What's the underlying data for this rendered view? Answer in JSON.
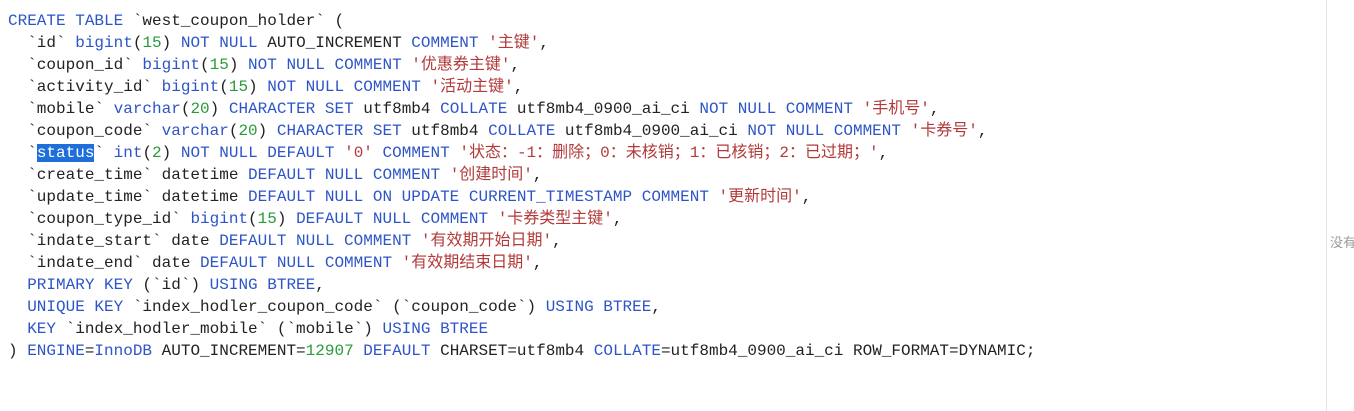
{
  "editor": {
    "lines": [
      [
        {
          "t": "CREATE TABLE",
          "k": "kw"
        },
        {
          "t": " `west_coupon_holder` (",
          "k": "plain"
        }
      ],
      [
        {
          "t": "  `id` ",
          "k": "plain"
        },
        {
          "t": "bigint",
          "k": "kw"
        },
        {
          "t": "(",
          "k": "plain"
        },
        {
          "t": "15",
          "k": "num"
        },
        {
          "t": ") ",
          "k": "plain"
        },
        {
          "t": "NOT NULL",
          "k": "kw"
        },
        {
          "t": " AUTO_INCREMENT ",
          "k": "plain"
        },
        {
          "t": "COMMENT",
          "k": "kw"
        },
        {
          "t": " ",
          "k": "plain"
        },
        {
          "t": "'主键'",
          "k": "str"
        },
        {
          "t": ",",
          "k": "plain"
        }
      ],
      [
        {
          "t": "  `coupon_id` ",
          "k": "plain"
        },
        {
          "t": "bigint",
          "k": "kw"
        },
        {
          "t": "(",
          "k": "plain"
        },
        {
          "t": "15",
          "k": "num"
        },
        {
          "t": ") ",
          "k": "plain"
        },
        {
          "t": "NOT NULL COMMENT",
          "k": "kw"
        },
        {
          "t": " ",
          "k": "plain"
        },
        {
          "t": "'优惠券主键'",
          "k": "str"
        },
        {
          "t": ",",
          "k": "plain"
        }
      ],
      [
        {
          "t": "  `activity_id` ",
          "k": "plain"
        },
        {
          "t": "bigint",
          "k": "kw"
        },
        {
          "t": "(",
          "k": "plain"
        },
        {
          "t": "15",
          "k": "num"
        },
        {
          "t": ") ",
          "k": "plain"
        },
        {
          "t": "NOT NULL COMMENT",
          "k": "kw"
        },
        {
          "t": " ",
          "k": "plain"
        },
        {
          "t": "'活动主键'",
          "k": "str"
        },
        {
          "t": ",",
          "k": "plain"
        }
      ],
      [
        {
          "t": "  `mobile` ",
          "k": "plain"
        },
        {
          "t": "varchar",
          "k": "kw"
        },
        {
          "t": "(",
          "k": "plain"
        },
        {
          "t": "20",
          "k": "num"
        },
        {
          "t": ") ",
          "k": "plain"
        },
        {
          "t": "CHARACTER SET",
          "k": "kw"
        },
        {
          "t": " utf8mb4 ",
          "k": "plain"
        },
        {
          "t": "COLLATE",
          "k": "kw"
        },
        {
          "t": " utf8mb4_0900_ai_ci ",
          "k": "plain"
        },
        {
          "t": "NOT NULL COMMENT",
          "k": "kw"
        },
        {
          "t": " ",
          "k": "plain"
        },
        {
          "t": "'手机号'",
          "k": "str"
        },
        {
          "t": ",",
          "k": "plain"
        }
      ],
      [
        {
          "t": "  `coupon_code` ",
          "k": "plain"
        },
        {
          "t": "varchar",
          "k": "kw"
        },
        {
          "t": "(",
          "k": "plain"
        },
        {
          "t": "20",
          "k": "num"
        },
        {
          "t": ") ",
          "k": "plain"
        },
        {
          "t": "CHARACTER SET",
          "k": "kw"
        },
        {
          "t": " utf8mb4 ",
          "k": "plain"
        },
        {
          "t": "COLLATE",
          "k": "kw"
        },
        {
          "t": " utf8mb4_0900_ai_ci ",
          "k": "plain"
        },
        {
          "t": "NOT NULL COMMENT",
          "k": "kw"
        },
        {
          "t": " ",
          "k": "plain"
        },
        {
          "t": "'卡券号'",
          "k": "str"
        },
        {
          "t": ",",
          "k": "plain"
        }
      ],
      [
        {
          "t": "  `",
          "k": "plain"
        },
        {
          "t": "status",
          "k": "sel"
        },
        {
          "t": "` ",
          "k": "plain"
        },
        {
          "t": "int",
          "k": "kw"
        },
        {
          "t": "(",
          "k": "plain"
        },
        {
          "t": "2",
          "k": "num"
        },
        {
          "t": ") ",
          "k": "plain"
        },
        {
          "t": "NOT NULL DEFAULT",
          "k": "kw"
        },
        {
          "t": " ",
          "k": "plain"
        },
        {
          "t": "'0'",
          "k": "str"
        },
        {
          "t": " ",
          "k": "plain"
        },
        {
          "t": "COMMENT",
          "k": "kw"
        },
        {
          "t": " ",
          "k": "plain"
        },
        {
          "t": "'状态：-1：删除；0：未核销；1：已核销；2：已过期；'",
          "k": "str"
        },
        {
          "t": ",",
          "k": "plain"
        }
      ],
      [
        {
          "t": "  `create_time` datetime ",
          "k": "plain"
        },
        {
          "t": "DEFAULT NULL COMMENT",
          "k": "kw"
        },
        {
          "t": " ",
          "k": "plain"
        },
        {
          "t": "'创建时间'",
          "k": "str"
        },
        {
          "t": ",",
          "k": "plain"
        }
      ],
      [
        {
          "t": "  `update_time` datetime ",
          "k": "plain"
        },
        {
          "t": "DEFAULT NULL ON UPDATE CURRENT_TIMESTAMP COMMENT",
          "k": "kw"
        },
        {
          "t": " ",
          "k": "plain"
        },
        {
          "t": "'更新时间'",
          "k": "str"
        },
        {
          "t": ",",
          "k": "plain"
        }
      ],
      [
        {
          "t": "  `coupon_type_id` ",
          "k": "plain"
        },
        {
          "t": "bigint",
          "k": "kw"
        },
        {
          "t": "(",
          "k": "plain"
        },
        {
          "t": "15",
          "k": "num"
        },
        {
          "t": ") ",
          "k": "plain"
        },
        {
          "t": "DEFAULT NULL COMMENT",
          "k": "kw"
        },
        {
          "t": " ",
          "k": "plain"
        },
        {
          "t": "'卡券类型主键'",
          "k": "str"
        },
        {
          "t": ",",
          "k": "plain"
        }
      ],
      [
        {
          "t": "  `indate_start` date ",
          "k": "plain"
        },
        {
          "t": "DEFAULT NULL COMMENT",
          "k": "kw"
        },
        {
          "t": " ",
          "k": "plain"
        },
        {
          "t": "'有效期开始日期'",
          "k": "str"
        },
        {
          "t": ",",
          "k": "plain"
        }
      ],
      [
        {
          "t": "  `indate_end` date ",
          "k": "plain"
        },
        {
          "t": "DEFAULT NULL COMMENT",
          "k": "kw"
        },
        {
          "t": " ",
          "k": "plain"
        },
        {
          "t": "'有效期结束日期'",
          "k": "str"
        },
        {
          "t": ",",
          "k": "plain"
        }
      ],
      [
        {
          "t": "  ",
          "k": "plain"
        },
        {
          "t": "PRIMARY KEY",
          "k": "kw"
        },
        {
          "t": " (`id`) ",
          "k": "plain"
        },
        {
          "t": "USING BTREE",
          "k": "kw"
        },
        {
          "t": ",",
          "k": "plain"
        }
      ],
      [
        {
          "t": "  ",
          "k": "plain"
        },
        {
          "t": "UNIQUE KEY",
          "k": "kw"
        },
        {
          "t": " `index_hodler_coupon_code` (`coupon_code`) ",
          "k": "plain"
        },
        {
          "t": "USING BTREE",
          "k": "kw"
        },
        {
          "t": ",",
          "k": "plain"
        }
      ],
      [
        {
          "t": "  ",
          "k": "plain"
        },
        {
          "t": "KEY",
          "k": "kw"
        },
        {
          "t": " `index_hodler_mobile` (`mobile`) ",
          "k": "plain"
        },
        {
          "t": "USING BTREE",
          "k": "kw"
        }
      ],
      [
        {
          "t": ") ",
          "k": "plain"
        },
        {
          "t": "ENGINE",
          "k": "kw"
        },
        {
          "t": "=",
          "k": "plain"
        },
        {
          "t": "InnoDB",
          "k": "kw"
        },
        {
          "t": " AUTO_INCREMENT=",
          "k": "plain"
        },
        {
          "t": "12907",
          "k": "num"
        },
        {
          "t": " ",
          "k": "plain"
        },
        {
          "t": "DEFAULT",
          "k": "kw"
        },
        {
          "t": " CHARSET=utf8mb4 ",
          "k": "plain"
        },
        {
          "t": "COLLATE",
          "k": "kw"
        },
        {
          "t": "=utf8mb4_0900_ai_ci ROW_FORMAT=DYNAMIC;",
          "k": "plain"
        }
      ]
    ]
  },
  "right_panel": {
    "text": "没有"
  },
  "colors": {
    "keyword": "#2e55c8",
    "number": "#2a9a3a",
    "string": "#b23a3a",
    "selection": "#1e6fd9"
  }
}
